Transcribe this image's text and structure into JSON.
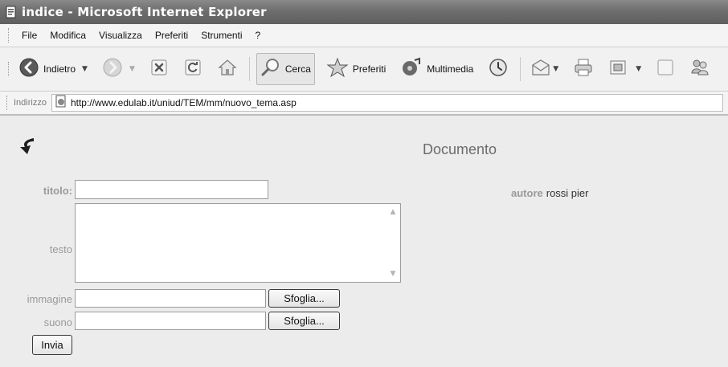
{
  "window": {
    "title": "indice - Microsoft Internet Explorer"
  },
  "menu": {
    "items": [
      "File",
      "Modifica",
      "Visualizza",
      "Preferiti",
      "Strumenti",
      "?"
    ]
  },
  "toolbar": {
    "back_label": "Indietro",
    "search_label": "Cerca",
    "favorites_label": "Preferiti",
    "media_label": "Multimedia"
  },
  "address": {
    "label": "Indirizzo",
    "url": "http://www.edulab.it/uniud/TEM/mm/nuovo_tema.asp"
  },
  "page": {
    "heading": "Documento",
    "author_label": "autore",
    "author_value": "rossi pier",
    "form": {
      "title_label": "titolo:",
      "title_value": "",
      "text_label": "testo",
      "text_value": "",
      "image_label": "immagine",
      "image_value": "",
      "sound_label": "suono",
      "sound_value": "",
      "browse_label": "Sfoglia...",
      "submit_label": "Invia"
    }
  },
  "colors": {
    "titlebar": "#6e6e6e",
    "page_background": "#ececec",
    "label_gray": "#9a9a9a"
  }
}
